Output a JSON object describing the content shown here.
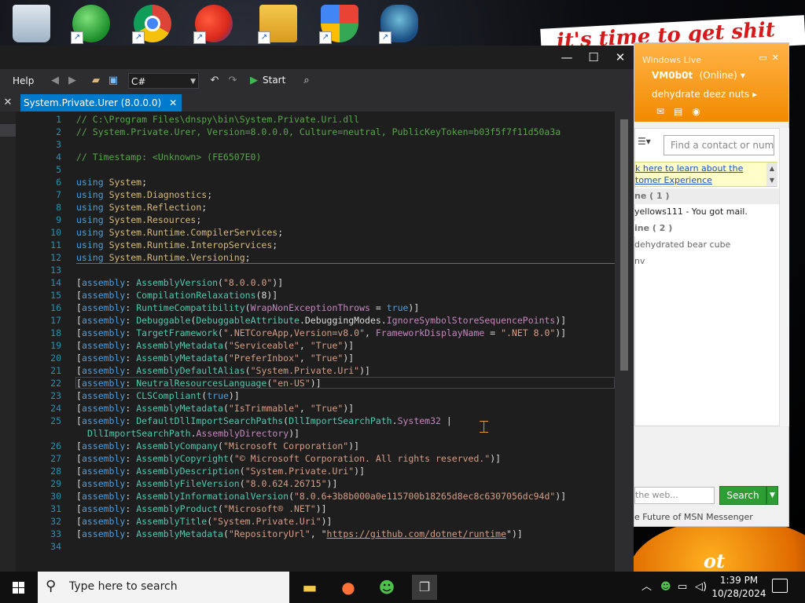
{
  "wallpaper": {
    "banner_text": "it's time to get shit",
    "pumpkin_text": "ot"
  },
  "desktop_icons": [
    {
      "name": "recycle-bin"
    },
    {
      "name": "windows-live-messenger"
    },
    {
      "name": "google-chrome"
    },
    {
      "name": "paint-app"
    },
    {
      "name": "folder"
    },
    {
      "name": "windows-security"
    },
    {
      "name": "game"
    }
  ],
  "dnspy": {
    "window_controls": {
      "minimize": "—",
      "maximize": "☐",
      "close": "✕"
    },
    "menu": {
      "help": "Help"
    },
    "language_combo": "C#",
    "start_label": "Start",
    "tab": {
      "title": "System.Private.Urer (8.0.0.0)",
      "close": "✕"
    },
    "side_close": "✕",
    "code_lines": [
      {
        "n": "1",
        "t": "// C:\\Program Files\\dnspy\\bin\\System.Private.Uri.dll"
      },
      {
        "n": "2",
        "t": "// System.Private.Urer, Version=8.0.0.0, Culture=neutral, PublicKeyToken=b03f5f7f11d50a3a"
      },
      {
        "n": "3",
        "t": ""
      },
      {
        "n": "4",
        "t": "// Timestamp: <Unknown> (FE6507E0)"
      },
      {
        "n": "5",
        "t": ""
      },
      {
        "n": "6",
        "t": "using System;"
      },
      {
        "n": "7",
        "t": "using System.Diagnostics;"
      },
      {
        "n": "8",
        "t": "using System.Reflection;"
      },
      {
        "n": "9",
        "t": "using System.Resources;"
      },
      {
        "n": "10",
        "t": "using System.Runtime.CompilerServices;"
      },
      {
        "n": "11",
        "t": "using System.Runtime.InteropServices;"
      },
      {
        "n": "12",
        "t": "using System.Runtime.Versioning;"
      },
      {
        "n": "13",
        "t": ""
      },
      {
        "n": "14",
        "t": "[assembly: AssemblyVersion(\"8.0.0.0\")]"
      },
      {
        "n": "15",
        "t": "[assembly: CompilationRelaxations(8)]"
      },
      {
        "n": "16",
        "t": "[assembly: RuntimeCompatibility(WrapNonExceptionThrows = true)]"
      },
      {
        "n": "17",
        "t": "[assembly: Debuggable(DebuggableAttribute.DebuggingModes.IgnoreSymbolStoreSequencePoints)]"
      },
      {
        "n": "18",
        "t": "[assembly: TargetFramework(\".NETCoreApp,Version=v8.0\", FrameworkDisplayName = \".NET 8.0\")]"
      },
      {
        "n": "19",
        "t": "[assembly: AssemblyMetadata(\"Serviceable\", \"True\")]"
      },
      {
        "n": "20",
        "t": "[assembly: AssemblyMetadata(\"PreferInbox\", \"True\")]"
      },
      {
        "n": "21",
        "t": "[assembly: AssemblyDefaultAlias(\"System.Private.Uri\")]"
      },
      {
        "n": "22",
        "t": "[assembly: NeutralResourcesLanguage(\"en-US\")]"
      },
      {
        "n": "23",
        "t": "[assembly: CLSCompliant(true)]"
      },
      {
        "n": "24",
        "t": "[assembly: AssemblyMetadata(\"IsTrimmable\", \"True\")]"
      },
      {
        "n": "25",
        "t": "[assembly: DefaultDllImportSearchPaths(DllImportSearchPath.System32 |"
      },
      {
        "n": "",
        "t": "DllImportSearchPath.AssemblyDirectory)]"
      },
      {
        "n": "26",
        "t": "[assembly: AssemblyCompany(\"Microsoft Corporation\")]"
      },
      {
        "n": "27",
        "t": "[assembly: AssemblyCopyright(\"© Microsoft Corporation. All rights reserved.\")]"
      },
      {
        "n": "28",
        "t": "[assembly: AssemblyDescription(\"System.Private.Uri\")]"
      },
      {
        "n": "29",
        "t": "[assembly: AssemblyFileVersion(\"8.0.624.26715\")]"
      },
      {
        "n": "30",
        "t": "[assembly: AssemblyInformationalVersion(\"8.0.6+3b8b000a0e115700b18265d8ec8c6307056dc94d\")]"
      },
      {
        "n": "31",
        "t": "[assembly: AssemblyProduct(\"Microsoft® .NET\")]"
      },
      {
        "n": "32",
        "t": "[assembly: AssemblyTitle(\"System.Private.Uri\")]"
      },
      {
        "n": "33",
        "t": "[assembly: AssemblyMetadata(\"RepositoryUrl\", \"https://github.com/dotnet/runtime\")]"
      },
      {
        "n": "34",
        "t": ""
      }
    ]
  },
  "messenger": {
    "title": "Windows Live",
    "display_name": "VM0b0t",
    "status": "(Online)",
    "personal_message": "dehydrate deez nuts",
    "find_placeholder": "Find a contact or numbe",
    "ad_line1": "k here to learn about the",
    "ad_line2": "tomer Experience",
    "groups": [
      {
        "label": "ne ( 1 )",
        "contacts": [
          "yellows111 - You got mail."
        ]
      },
      {
        "label": "ine ( 2 )",
        "contacts": [
          "dehydrated bear cube",
          "nv"
        ]
      }
    ],
    "web_search_placeholder": "the web...",
    "search_button": "Search",
    "footer": "e Future of MSN Messenger"
  },
  "taskbar": {
    "search_placeholder": "Type here to search",
    "time": "1:39 PM",
    "date": "10/28/2024"
  }
}
